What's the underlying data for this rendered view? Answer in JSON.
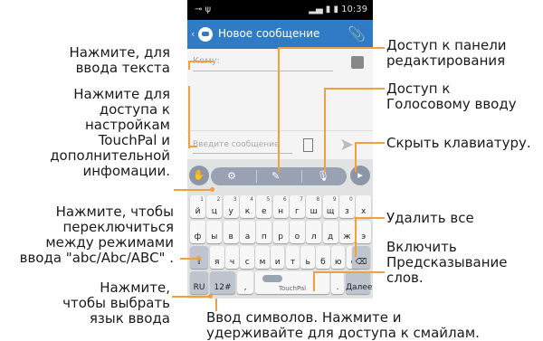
{
  "phone": {
    "status": {
      "left": "⊸ ψ",
      "right": "▂▄ ▮ ▮ 10:39"
    },
    "action_bar": {
      "back": "‹",
      "title": "Новое сообщение"
    },
    "compose": {
      "to_placeholder": "Кому:",
      "message_placeholder": "Введите сообщение"
    },
    "keyboard": {
      "row1": [
        {
          "m": "й",
          "s": "1"
        },
        {
          "m": "ц",
          "s": "2"
        },
        {
          "m": "у",
          "s": "3"
        },
        {
          "m": "к",
          "s": "4"
        },
        {
          "m": "е",
          "s": "5"
        },
        {
          "m": "н",
          "s": "6"
        },
        {
          "m": "г",
          "s": "7"
        },
        {
          "m": "ш",
          "s": "8"
        },
        {
          "m": "щ",
          "s": "9"
        },
        {
          "m": "з",
          "s": "0"
        },
        {
          "m": "х",
          "s": ""
        }
      ],
      "row2": [
        {
          "m": "ф",
          "s": ""
        },
        {
          "m": "ы",
          "s": ""
        },
        {
          "m": "в",
          "s": ""
        },
        {
          "m": "а",
          "s": ""
        },
        {
          "m": "п",
          "s": ""
        },
        {
          "m": "р",
          "s": ""
        },
        {
          "m": "о",
          "s": ""
        },
        {
          "m": "л",
          "s": ""
        },
        {
          "m": "д",
          "s": ""
        },
        {
          "m": "ж",
          "s": ""
        },
        {
          "m": "э",
          "s": ""
        }
      ],
      "row3": [
        {
          "m": "я",
          "s": ""
        },
        {
          "m": "ч",
          "s": ""
        },
        {
          "m": "с",
          "s": ""
        },
        {
          "m": "м",
          "s": ""
        },
        {
          "m": "и",
          "s": ""
        },
        {
          "m": "т",
          "s": ""
        },
        {
          "m": "ь",
          "s": ""
        },
        {
          "m": "б",
          "s": ""
        },
        {
          "m": "ю",
          "s": ""
        },
        {
          "m": "ё",
          "s": ""
        }
      ],
      "shift": "⇧",
      "delete": "⌫",
      "lang": "RU",
      "symbols": "12#",
      "comma": ",",
      "space_label": "TouchPal",
      "period": ".",
      "enter": "Далее"
    }
  },
  "annotations": {
    "tap_input": "Нажмите, для\nввода текста",
    "touchpal_settings": "Нажмите для\nдоступа к\nнастройкам\nTouchPal и\nдополнительной\nинфомации.",
    "switch_modes": "Нажмите, чтобы\nпереключиться\nмежду режимами\nввода \"abc/Abc/ABC\" .",
    "select_language": "Нажмите,\nчтобы выбрать\nязык ввода",
    "edit_panel": "Доступ к панели\nредактирования",
    "voice_input": "Доступ к\nГолосовому вводу",
    "hide_keyboard": "Скрыть клавиатуру.",
    "delete_all": "Удалить все",
    "enable_prediction": "Включить\nПредсказывание\nслов.",
    "symbols_input": "Ввод символов. Нажмите и\nудерживайте для доступа к смайлам."
  },
  "colors": {
    "leader": "#f0a040",
    "action_bar": "#2f7bc6",
    "keyboard_bg": "#e1e2e2"
  }
}
